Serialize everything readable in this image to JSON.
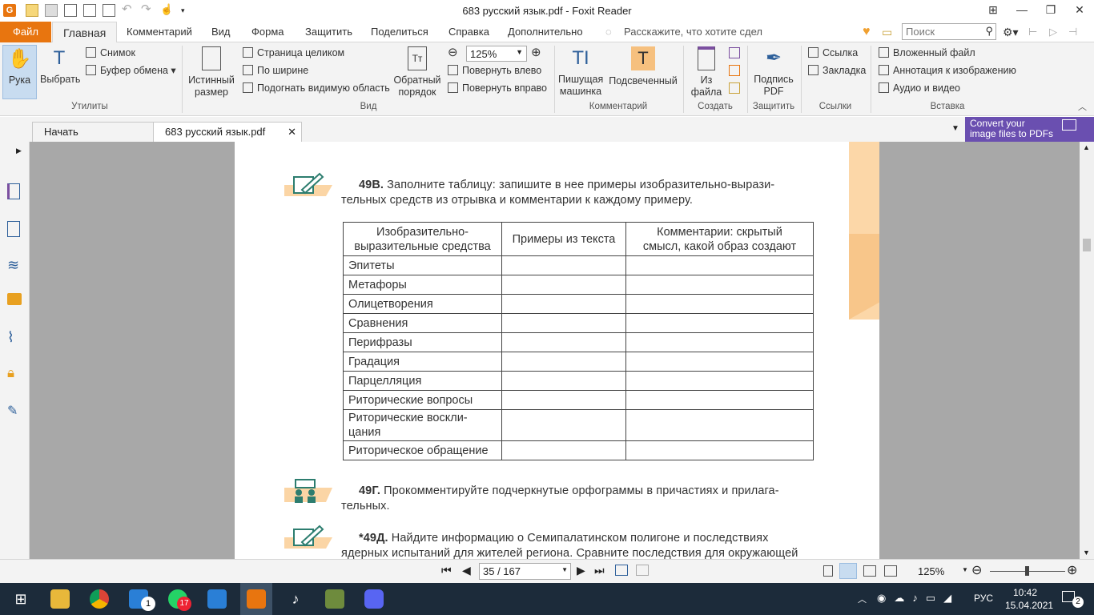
{
  "window": {
    "title": "683 русский язык.pdf - Foxit Reader"
  },
  "tabs": {
    "file": "Файл",
    "home": "Главная",
    "comment": "Комментарий",
    "view": "Вид",
    "form": "Форма",
    "protect": "Защитить",
    "share": "Поделиться",
    "help": "Справка",
    "extra": "Дополнительно",
    "tellme": "Расскажите, что хотите сдел",
    "search_placeholder": "Поиск"
  },
  "ribbon": {
    "hand": "Рука",
    "select": "Выбрать",
    "snapshot": "Снимок",
    "clipboard": "Буфер обмена",
    "utilities": "Утилиты",
    "actual1": "Истинный",
    "actual2": "размер",
    "fitpage": "Страница целиком",
    "fitwidth": "По ширине",
    "fitvisible": "Подогнать видимую область",
    "reverse1": "Обратный",
    "reverse2": "порядок",
    "zoom": "125%",
    "rotleft": "Повернуть влево",
    "rotright": "Повернуть вправо",
    "view_group": "Вид",
    "typewriter1": "Пишущая",
    "typewriter2": "машинка",
    "highlight": "Подсвеченный",
    "comment_group": "Комментарий",
    "fromfile1": "Из",
    "fromfile2": "файла",
    "create_group": "Создать",
    "sign1": "Подпись",
    "sign2": "PDF",
    "protect_group": "Защитить",
    "link": "Ссылка",
    "bookmark": "Закладка",
    "links_group": "Ссылки",
    "attach": "Вложенный файл",
    "imgannot": "Аннотация к изображению",
    "audiovideo": "Аудио и видео",
    "insert_group": "Вставка"
  },
  "doctabs": {
    "start": "Начать",
    "file": "683 русский язык.pdf",
    "promo1": "Convert your",
    "promo2": "image files to PDFs"
  },
  "page": {
    "ex1_num": "49В.",
    "ex1_line1": "Заполните таблицу: запишите в нее примеры изобразительно-вырази-",
    "ex1_line2": "тельных средств из отрывка и комментарии к каждому примеру.",
    "col1a": "Изобразительно-",
    "col1b": "выразительные средства",
    "col2": "Примеры из текста",
    "col3a": "Комментарии: скрытый",
    "col3b": "смысл, какой образ создают",
    "rows": [
      "Эпитеты",
      "Метафоры",
      "Олицетворения",
      "Сравнения",
      "Перифразы",
      "Градация",
      "Парцелляция",
      "Риторические вопросы",
      "Риторические воскли-",
      "цания",
      "Риторическое обращение"
    ],
    "ex2_num": "49Г.",
    "ex2_line1": "Прокомментируйте подчеркнутые орфограммы в причастиях и прилага-",
    "ex2_line2": "тельных.",
    "ex3_num": "*49Д.",
    "ex3_line1": "Найдите информацию о Семипалатинском полигоне и последствиях",
    "ex3_line2": "ядерных испытаний для жителей региона. Сравните последствия для окружающей"
  },
  "status": {
    "page": "35 / 167",
    "zoom": "125%"
  },
  "taskbar": {
    "mail_badge": "1",
    "wa_badge": "17",
    "lang": "РУС",
    "time": "10:42",
    "date": "15.04.2021",
    "notif": "2"
  },
  "colors": {
    "accent": "#e8750f",
    "ribbon": "#f3f3f3",
    "doc_bg": "#a8a8a8",
    "taskbar": "#1c2b3a"
  }
}
